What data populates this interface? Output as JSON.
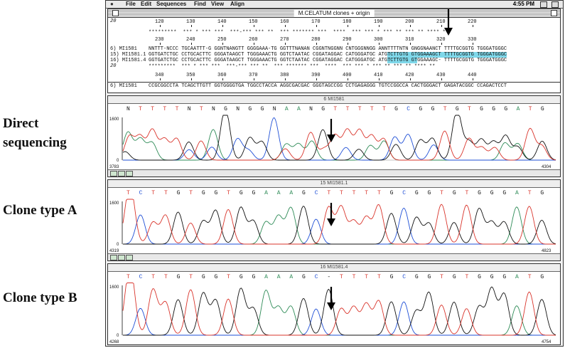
{
  "labels": {
    "direct": "Direct\nsequencing",
    "clone_a": "Clone type A",
    "clone_b": "Clone type B"
  },
  "menubar": {
    "items": [
      "File",
      "Edit",
      "Sequences",
      "Find",
      "View",
      "Align"
    ],
    "clock": "4:55 PM"
  },
  "seq_window": {
    "title": "M.CELATUM clones + origin",
    "row_label_top": "20",
    "row_label_mid": "20",
    "ruler1": [
      "120",
      "130",
      "140",
      "150",
      "160",
      "170",
      "180",
      "190",
      "200",
      "210",
      "220"
    ],
    "consensus1": "*********  *** * *** ***  ***-*** *** **  *** ******* ***  ****  *** *** * *** ** *** ** **** **",
    "ruler2": [
      "230",
      "240",
      "250",
      "260",
      "270",
      "280",
      "290",
      "300",
      "310",
      "320",
      "330"
    ],
    "rows": [
      {
        "name": "6) MI1581",
        "seq": "NNTTT-NCCC TGCAATTT-G GGNTNANGTT GGGGAAA-TG GGTTTNANAN CGGNTNGGNN CNTGGGNNGG ANNTTTTNTN GNGGNAANCT TTTTGCGGTG TGGGATGGGC"
      },
      {
        "name": "15) MI1581.1",
        "seq": "GGTGATCTGC CCTGCACTTC GGGATAAGCT TGGGAAACTG GGTCTAATAC CGGATAGGAC CATGGGATGC ATGTCTTGTG GTGGAAAGCT TTTTGCGGTG TGGGATGGGC"
      },
      {
        "name": "16) MI1581.4",
        "seq": "GGTGATCTGC CCTGCACTTC GGGATAAGCT TGGGAAACTG GGTCTAATAC CGGATAGGAC CATGGGATGC ATGTCTTGTG GTGGAAAGC- TTTTGCGGTG TGGGATGGGC"
      }
    ],
    "consensus2": "*********  *** * *** ***  ***-*** *** **  *** ******* ***  ****  *** *** * *** ** *** ** **** **",
    "ruler3": [
      "340",
      "350",
      "360",
      "370",
      "380",
      "390",
      "400",
      "410",
      "420",
      "430",
      "440"
    ],
    "row_bottom": {
      "name": "6) MI1581",
      "seq": "CCGCGGCCTA TCAGCTTGTT GGTGGGGTGA TGGCCTACCA AGGCGACGAC GGGTAGCCGG CCTGAGAGGG TGTCCGGCCA CACTGGGACT GAGATACGGC CCAGACTCCT"
    }
  },
  "traces": [
    {
      "title": "6 MI1581",
      "bases": "NTTTTNTNGNGGNAANGTTTTTGCGGTGTGGGATG",
      "ymax": "1600",
      "ymin": "0",
      "start": "3783",
      "end": "4304"
    },
    {
      "title": "15 MI1581.1",
      "bases": "TCTTGTGGTGGAAAGCTTTTTGCGGTGTGGGATG",
      "ymax": "1600",
      "ymin": "0",
      "start": "4319",
      "end": "4823"
    },
    {
      "title": "16 MI1581.4",
      "bases": "TCTTGTGGTGGAAAGC-TTTTGCGGTGTGGGATG",
      "ymax": "1600",
      "ymin": "0",
      "start": "4268",
      "end": "4754"
    }
  ],
  "colors": {
    "A": "#2e8b57",
    "C": "#1f4fd6",
    "G": "#111111",
    "T": "#d9342b",
    "N": "#111111",
    "highlight": "#7fd8ea"
  }
}
